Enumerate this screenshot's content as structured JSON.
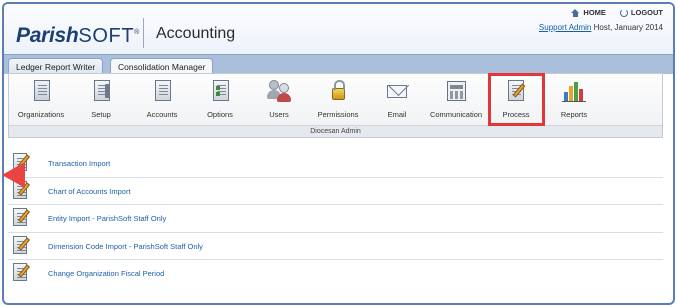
{
  "header": {
    "logo_main": "Parish",
    "logo_soft": "SOFT",
    "logo_tm": "®",
    "app_title": "Accounting",
    "home_label": "HOME",
    "logout_label": "LOGOUT",
    "user_link": "Support Admin",
    "user_context": " Host, January 2014"
  },
  "tabs": [
    {
      "label": "Ledger Report Writer",
      "active": false
    },
    {
      "label": "Consolidation Manager",
      "active": true
    }
  ],
  "toolbar": {
    "items": [
      {
        "label": "Organizations",
        "icon": "organizations-icon"
      },
      {
        "label": "Setup",
        "icon": "setup-icon"
      },
      {
        "label": "Accounts",
        "icon": "accounts-icon"
      },
      {
        "label": "Options",
        "icon": "options-icon"
      },
      {
        "label": "Users",
        "icon": "users-icon"
      },
      {
        "label": "Permissions",
        "icon": "lock-icon"
      },
      {
        "label": "Email",
        "icon": "envelope-icon"
      },
      {
        "label": "Communication",
        "icon": "communication-icon"
      },
      {
        "label": "Process",
        "icon": "process-icon",
        "highlighted": true
      },
      {
        "label": "Reports",
        "icon": "bar-chart-icon"
      }
    ],
    "section_label": "Diocesan Admin"
  },
  "process_list": {
    "items": [
      {
        "label": "Transaction Import"
      },
      {
        "label": "Chart of Accounts Import"
      },
      {
        "label": "Entity Import - ParishSoft Staff Only"
      },
      {
        "label": "Dimension Code Import - ParishSoft Staff Only"
      },
      {
        "label": "Change Organization Fiscal Period"
      }
    ]
  },
  "colors": {
    "frame_border": "#5b7fb4",
    "tab_bar": "#aabfdc",
    "link": "#1f5fa8",
    "highlight": "#e0373a",
    "pointer_arrow": "#e94343"
  }
}
